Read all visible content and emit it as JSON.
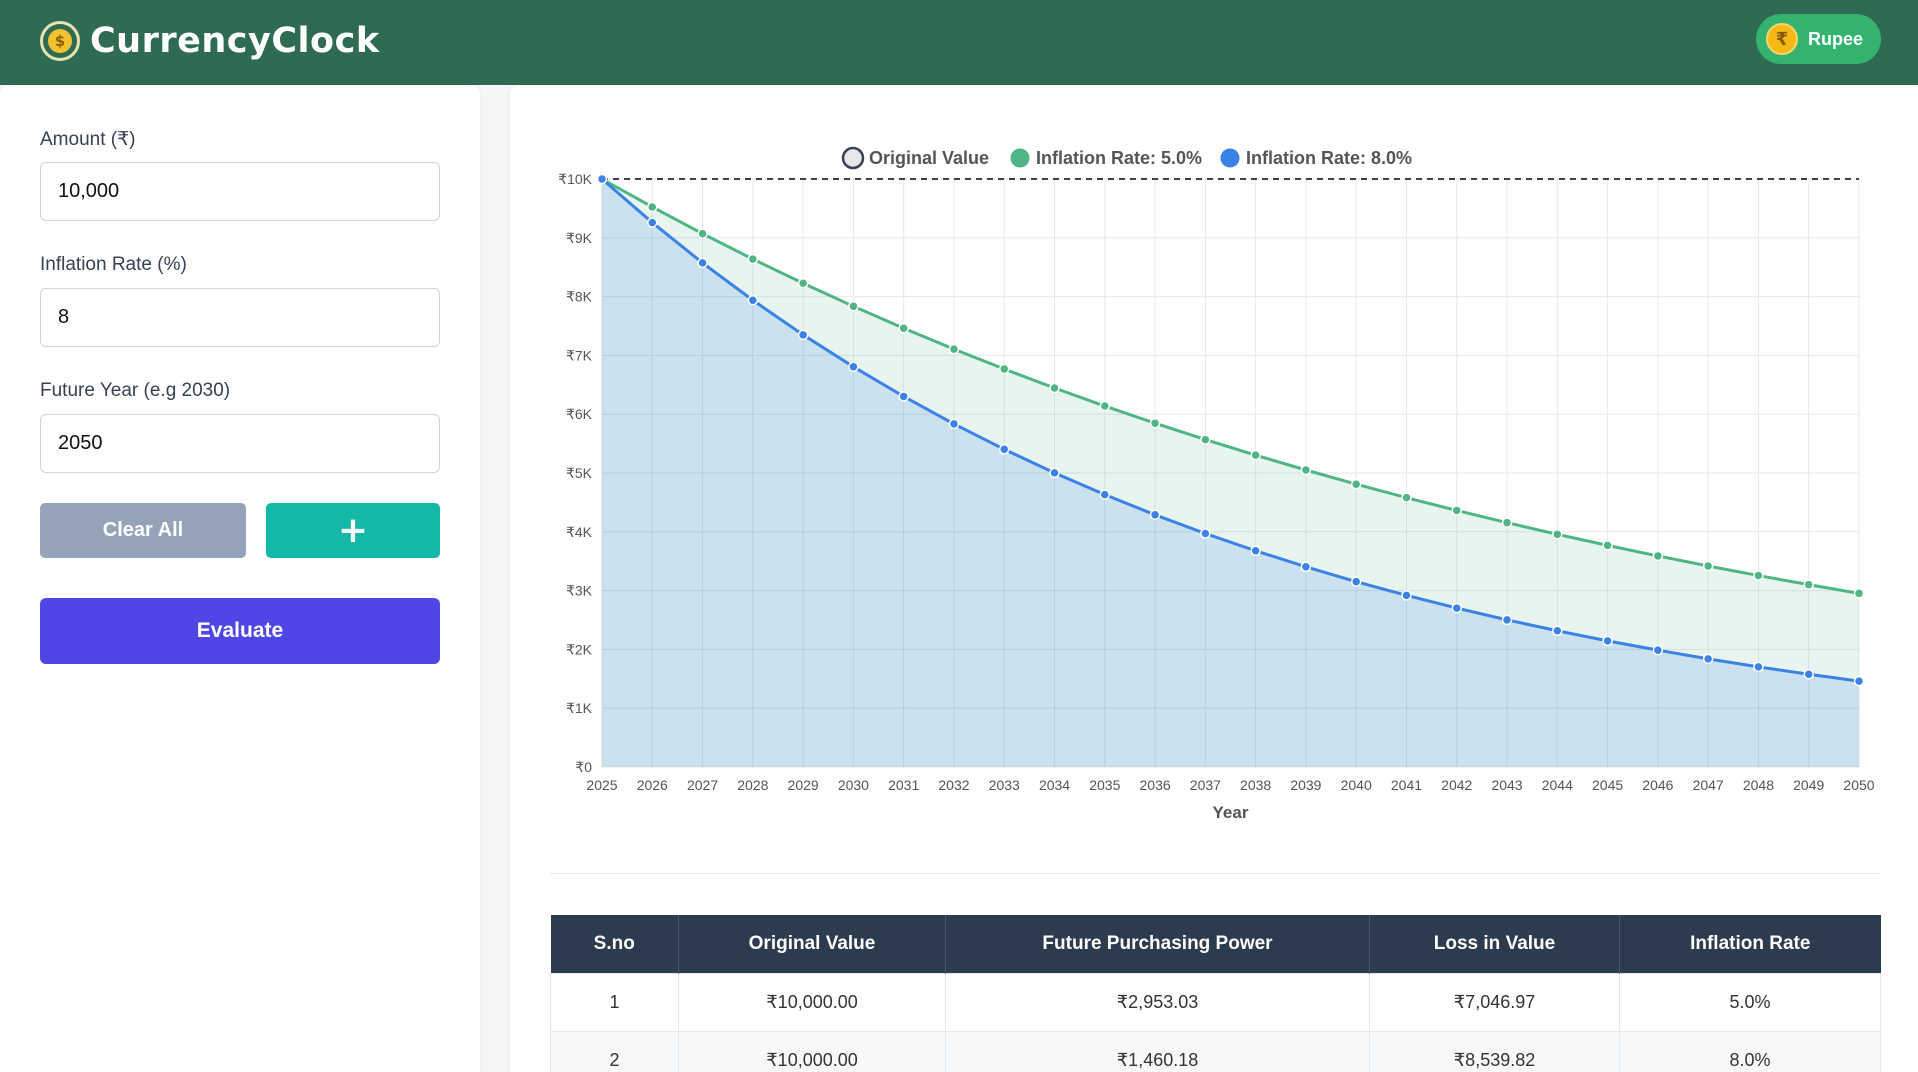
{
  "app": {
    "title": "CurrencyClock",
    "currency_toggle": {
      "symbol": "₹",
      "label": "Rupee"
    }
  },
  "form": {
    "amount": {
      "label": "Amount (₹)",
      "value": "10,000"
    },
    "inflation": {
      "label": "Inflation Rate (%)",
      "value": "8"
    },
    "year": {
      "label": "Future Year (e.g 2030)",
      "value": "2050"
    },
    "clear_label": "Clear All",
    "add_label": "+",
    "evaluate_label": "Evaluate"
  },
  "chart_data": {
    "type": "area",
    "xlabel": "Year",
    "ylabel": "",
    "ylim": [
      0,
      10000
    ],
    "y_ticks": [
      "₹0",
      "₹1K",
      "₹2K",
      "₹3K",
      "₹4K",
      "₹5K",
      "₹6K",
      "₹7K",
      "₹8K",
      "₹9K",
      "₹10K"
    ],
    "x": [
      2025,
      2026,
      2027,
      2028,
      2029,
      2030,
      2031,
      2032,
      2033,
      2034,
      2035,
      2036,
      2037,
      2038,
      2039,
      2040,
      2041,
      2042,
      2043,
      2044,
      2045,
      2046,
      2047,
      2048,
      2049,
      2050
    ],
    "legend_position": "top",
    "grid": true,
    "series": [
      {
        "name": "Original Value",
        "color": "#374151",
        "style": "dashed",
        "values": [
          10000,
          10000,
          10000,
          10000,
          10000,
          10000,
          10000,
          10000,
          10000,
          10000,
          10000,
          10000,
          10000,
          10000,
          10000,
          10000,
          10000,
          10000,
          10000,
          10000,
          10000,
          10000,
          10000,
          10000,
          10000,
          10000
        ]
      },
      {
        "name": "Inflation Rate: 5.0%",
        "color": "#4fb584",
        "values": [
          10000,
          9524,
          9070,
          8638,
          8227,
          7835,
          7462,
          7107,
          6768,
          6446,
          6139,
          5847,
          5568,
          5303,
          5051,
          4810,
          4581,
          4363,
          4155,
          3957,
          3769,
          3589,
          3418,
          3256,
          3101,
          2953
        ]
      },
      {
        "name": "Inflation Rate: 8.0%",
        "color": "#3b82e6",
        "values": [
          10000,
          9259,
          8573,
          7938,
          7350,
          6806,
          6302,
          5835,
          5403,
          5002,
          4632,
          4289,
          3971,
          3677,
          3405,
          3152,
          2919,
          2703,
          2502,
          2317,
          2145,
          1987,
          1839,
          1703,
          1577,
          1460
        ]
      }
    ]
  },
  "table": {
    "headers": [
      "S.no",
      "Original Value",
      "Future Purchasing Power",
      "Loss in Value",
      "Inflation Rate"
    ],
    "rows": [
      [
        "1",
        "₹10,000.00",
        "₹2,953.03",
        "₹7,046.97",
        "5.0%"
      ],
      [
        "2",
        "₹10,000.00",
        "₹1,460.18",
        "₹8,539.82",
        "8.0%"
      ]
    ]
  }
}
